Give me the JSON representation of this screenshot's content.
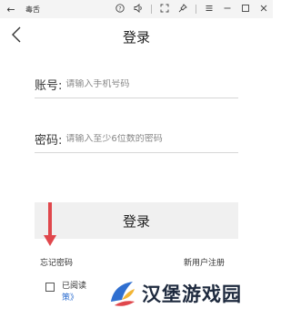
{
  "titlebar": {
    "back_icon": "arrow-left-icon",
    "title": "毒舌",
    "icons": [
      "help-icon",
      "volume-icon",
      "fullscreen-icon",
      "pin-icon",
      "menu-icon",
      "minimize-icon",
      "maximize-icon",
      "close-icon"
    ]
  },
  "nav": {
    "back_icon": "chevron-left-icon",
    "title": "登录"
  },
  "form": {
    "account_label": "账号:",
    "account_placeholder": "请输入手机号码",
    "password_label": "密码:",
    "password_placeholder": "请输入至少6位数的密码",
    "login_button": "登录"
  },
  "links": {
    "forgot_password": "忘记密码",
    "register": "新用户注册"
  },
  "agreement": {
    "read_label": "已阅读",
    "policy_fragment": "策》"
  },
  "watermark": {
    "text": "汉堡游戏园"
  },
  "colors": {
    "arrow": "#e0474c",
    "policy_link": "#2f6fd0",
    "button_bg": "#f0f0f0"
  }
}
